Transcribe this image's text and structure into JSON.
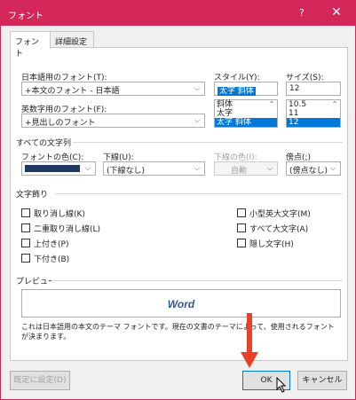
{
  "window": {
    "title": "フォント",
    "help": "?",
    "close": "✕"
  },
  "tabs": [
    "フォント",
    "詳細設定"
  ],
  "fonts": {
    "jp_label": "日本語用のフォント(T):",
    "jp_value": "+本文のフォント - 日本語",
    "en_label": "英数字用のフォント(F):",
    "en_value": "+見出しのフォント"
  },
  "style": {
    "label": "スタイル(Y):",
    "value": "太字 斜体",
    "options": [
      "斜体",
      "太字",
      "太字 斜体"
    ],
    "selected": "太字 斜体"
  },
  "size": {
    "label": "サイズ(S):",
    "value": "12",
    "options": [
      "10.5",
      "11",
      "12"
    ],
    "selected": "12"
  },
  "all_text": {
    "section": "すべての文字列",
    "color_label": "フォントの色(C):",
    "color_value": "#1f3864",
    "underline_label": "下線(U):",
    "underline_value": "(下線なし)",
    "underline_color_label": "下線の色(I):",
    "underline_color_value": "自動",
    "emphasis_label": "傍点(;)",
    "emphasis_value": "(傍点なし)"
  },
  "effects": {
    "section": "文字飾り",
    "left": [
      "取り消し線(K)",
      "二重取り消し線(L)",
      "上付き(P)",
      "下付き(B)"
    ],
    "right": [
      "小型英大文字(M)",
      "すべて大文字(A)",
      "隠し文字(H)"
    ]
  },
  "preview": {
    "section": "プレビュー",
    "sample": "Word",
    "note": "これは日本語用の本文のテーマ フォントです。現在の文書のテーマによって、使用されるフォントが決まります。"
  },
  "buttons": {
    "default": "既定に設定(D)",
    "ok": "OK",
    "cancel": "キャンセル"
  },
  "colors": {
    "accent": "#d3275a",
    "arrow": "#e8402a",
    "selection": "#0078d7"
  }
}
